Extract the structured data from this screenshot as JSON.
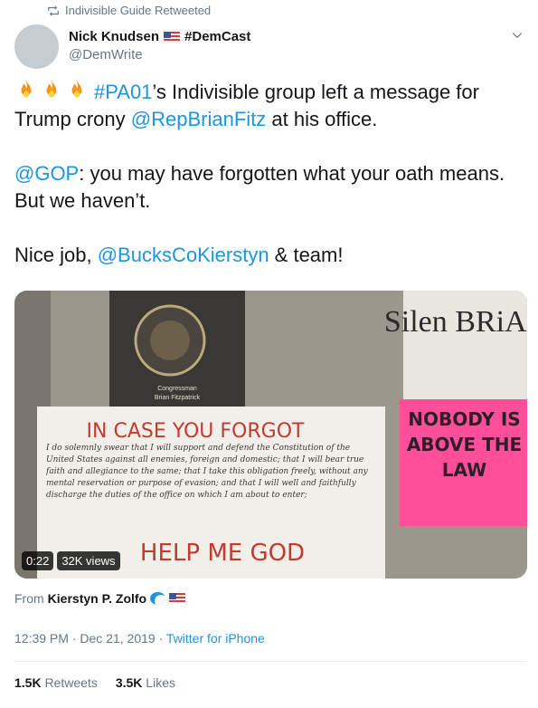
{
  "retweet_header": {
    "icon": "retweet-icon",
    "text": "Indivisible Guide Retweeted"
  },
  "author": {
    "name": "Nick Knudsen",
    "flag": "us-flag",
    "hashtag": "#DemCast",
    "handle": "@DemWrite"
  },
  "tweet": {
    "line1_hashtag": "#PA01",
    "line1_text": "’s Indivisible group left a message for Trump crony ",
    "line1_mention": "@RepBrianFitz",
    "line1_end": " at his office.",
    "line2_mention": "@GOP",
    "line2_text": ": you may have forgotten what your oath means. But we haven’t.",
    "line3_text": "Nice job, ",
    "line3_mention": "@BucksCoKierstyn",
    "line3_end": " & team!"
  },
  "media": {
    "duration": "0:22",
    "views": "32K views",
    "plaque_line1": "Congressman",
    "plaque_line2": "Brian Fitzpatrick",
    "sign_heading": "IN CASE YOU FORGOT",
    "sign_body": "I do solemnly swear that I will support and defend the Constitution of the United States against all enemies, foreign and domestic; that I will bear true faith and allegiance to the same; that I take this obligation freely, without any mental reservation or purpose of evasion; and that I will well and faithfully discharge the duties of the office on which I am about to enter;",
    "sign_footer": "HELP ME GOD",
    "sign_top_right": "Silen BRiAN",
    "pink_sign": "NOBODY IS ABOVE THE LAW"
  },
  "source": {
    "prefix": "From",
    "name": "Kierstyn P. Zolfo"
  },
  "meta": {
    "time": "12:39 PM",
    "date": "Dec 21, 2019",
    "client": "Twitter for iPhone"
  },
  "stats": {
    "retweets_count": "1.5K",
    "retweets_label": "Retweets",
    "likes_count": "3.5K",
    "likes_label": "Likes"
  },
  "colors": {
    "link": "#1b95e0",
    "muted": "#657786",
    "pink_sign": "#ff4f9a",
    "sign_text": "#c23b2e"
  }
}
